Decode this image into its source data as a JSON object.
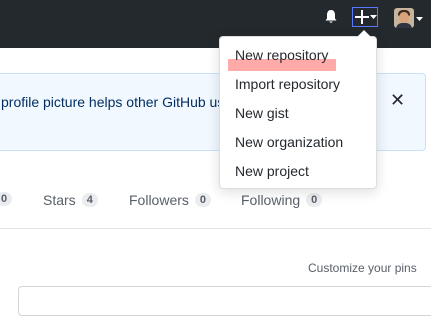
{
  "header": {
    "icons": {
      "bell": "bell-icon",
      "plus": "plus-icon",
      "caret": "chevron-down-icon"
    }
  },
  "create_menu": {
    "items": [
      {
        "label": "New repository",
        "highlighted": true
      },
      {
        "label": "Import repository"
      },
      {
        "label": "New gist"
      },
      {
        "label": "New organization"
      },
      {
        "label": "New project"
      }
    ]
  },
  "flash": {
    "text": "profile picture helps other GitHub use",
    "close_label": "✕"
  },
  "profile_nav": {
    "leading_counter": "0",
    "tabs": [
      {
        "label": "Stars",
        "count": "4"
      },
      {
        "label": "Followers",
        "count": "0"
      },
      {
        "label": "Following",
        "count": "0"
      }
    ]
  },
  "pinned": {
    "customize_label": "Customize your pins"
  },
  "colors": {
    "header_bg": "#24292e",
    "flash_bg": "#f1f8ff",
    "flash_border": "#c8e1ff",
    "link_text": "#032f62",
    "green_button": "#28a745",
    "focus_ring": "#5a77ff",
    "highlight_mark": "#ff9a9a"
  }
}
